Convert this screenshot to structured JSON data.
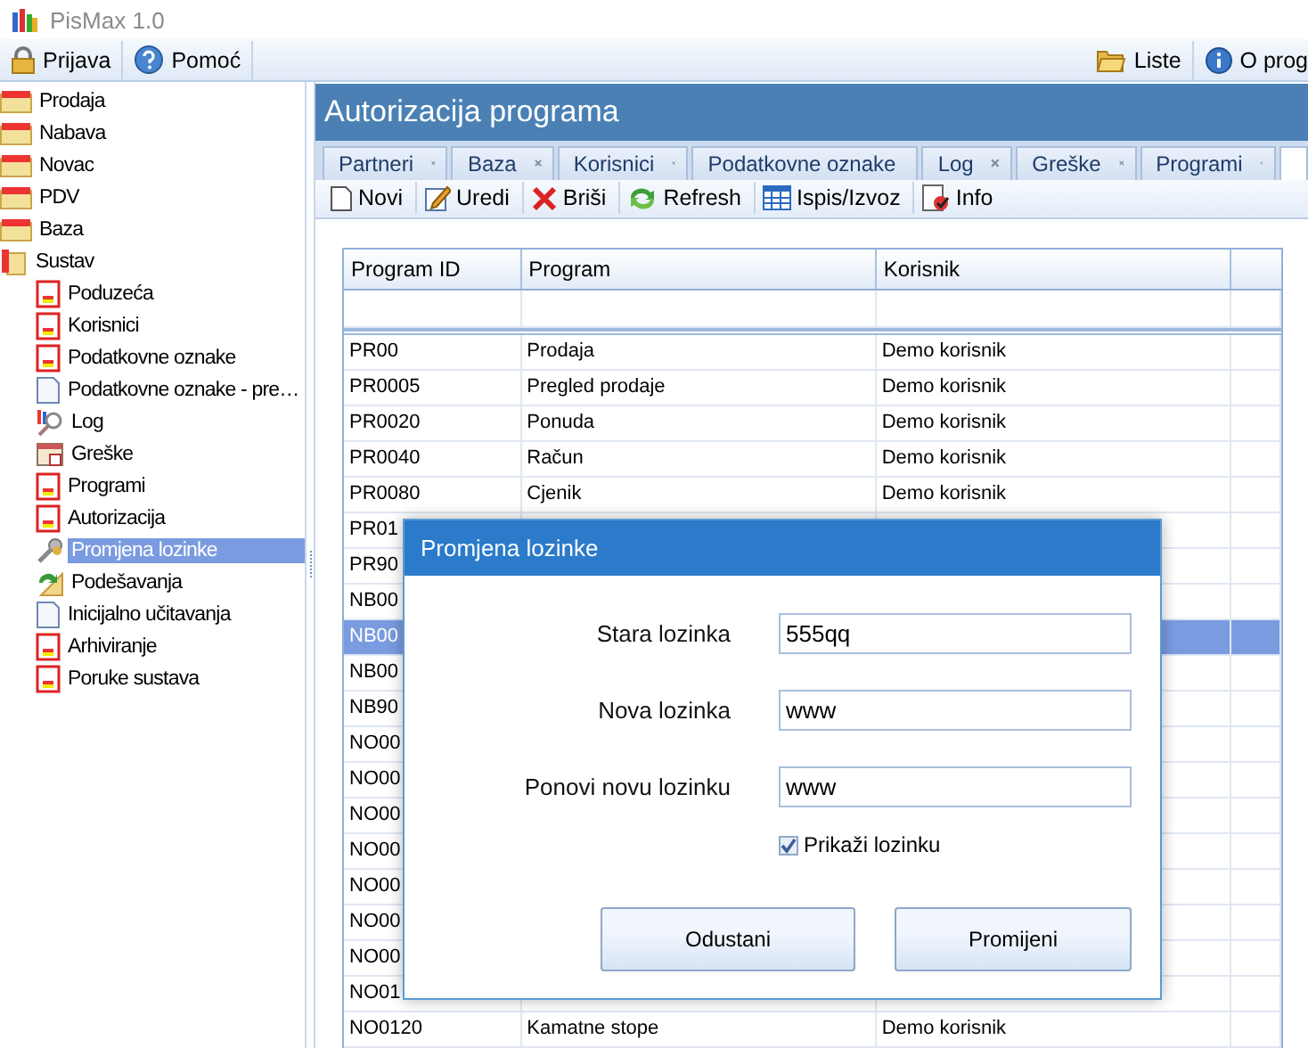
{
  "window": {
    "title": "PisMax 1.0"
  },
  "menu_bar": {
    "left": [
      {
        "label": "Prijava"
      },
      {
        "label": "Pomoć"
      }
    ],
    "right": [
      {
        "label": "Liste"
      },
      {
        "label": "O prog"
      }
    ]
  },
  "sidebar": {
    "items": [
      {
        "label": "Prodaja",
        "selected": false
      },
      {
        "label": "Nabava",
        "selected": false
      },
      {
        "label": "Novac",
        "selected": false
      },
      {
        "label": "PDV",
        "selected": false
      },
      {
        "label": "Baza",
        "selected": false
      },
      {
        "label": "Sustav",
        "selected": false,
        "expanded": true,
        "children": [
          {
            "label": "Poduzeća",
            "selected": false
          },
          {
            "label": "Korisnici",
            "selected": false
          },
          {
            "label": "Podatkovne oznake",
            "selected": false
          },
          {
            "label": "Podatkovne oznake - pre…",
            "selected": false
          },
          {
            "label": "Log",
            "selected": false
          },
          {
            "label": "Greške",
            "selected": false
          },
          {
            "label": "Programi",
            "selected": false
          },
          {
            "label": "Autorizacija",
            "selected": false
          },
          {
            "label": "Promjena lozinke",
            "selected": true
          },
          {
            "label": "Podešavanja",
            "selected": false
          },
          {
            "label": "Inicijalno učitavanja",
            "selected": false
          },
          {
            "label": "Arhiviranje",
            "selected": false
          },
          {
            "label": "Poruke sustava",
            "selected": false
          }
        ]
      }
    ]
  },
  "panel": {
    "title": "Autorizacija programa"
  },
  "tabs": [
    {
      "label": "Partneri",
      "selected": false
    },
    {
      "label": "Baza",
      "selected": false
    },
    {
      "label": "Korisnici",
      "selected": false
    },
    {
      "label": "Podatkovne oznake",
      "selected": false
    },
    {
      "label": "Log",
      "selected": false
    },
    {
      "label": "Greške",
      "selected": false
    },
    {
      "label": "Programi",
      "selected": false
    },
    {
      "selected": true
    }
  ],
  "toolbar": [
    "Novi",
    "Uredi",
    "Briši",
    "Refresh",
    "Ispis/Izvoz",
    "Info"
  ],
  "table": {
    "columns": [
      "Program ID",
      "Program",
      "Korisnik"
    ],
    "rows": [
      {
        "id": "PR00",
        "program": "Prodaja",
        "user": "Demo korisnik",
        "selected": false
      },
      {
        "id": "PR0005",
        "program": "Pregled prodaje",
        "user": "Demo korisnik",
        "selected": false
      },
      {
        "id": "PR0020",
        "program": "Ponuda",
        "user": "Demo korisnik",
        "selected": false
      },
      {
        "id": "PR0040",
        "program": "Račun",
        "user": "Demo korisnik",
        "selected": false
      },
      {
        "id": "PR0080",
        "program": "Cjenik",
        "user": "Demo korisnik",
        "selected": false
      },
      {
        "id": "PR01",
        "selected": false
      },
      {
        "id": "PR90",
        "selected": false
      },
      {
        "id": "NB00",
        "selected": false
      },
      {
        "id": "NB00",
        "selected": true
      },
      {
        "id": "NB00",
        "selected": false
      },
      {
        "id": "NB90",
        "selected": false
      },
      {
        "id": "NO00",
        "selected": false
      },
      {
        "id": "NO00",
        "selected": false
      },
      {
        "id": "NO00",
        "selected": false
      },
      {
        "id": "NO00",
        "selected": false
      },
      {
        "id": "NO00",
        "selected": false
      },
      {
        "id": "NO00",
        "selected": false
      },
      {
        "id": "NO00",
        "selected": false
      },
      {
        "id": "NO01",
        "selected": false
      },
      {
        "id": "NO0120",
        "program": "Kamatne stope",
        "user": "Demo korisnik",
        "selected": false
      }
    ]
  },
  "dialog": {
    "title": "Promjena lozinke",
    "fields": [
      {
        "label": "Stara lozinka",
        "value": "555qq"
      },
      {
        "label": "Nova lozinka",
        "value": "www"
      },
      {
        "label": "Ponovi novu lozinku",
        "value": "www"
      }
    ],
    "show_password": {
      "label": "Prikaži lozinku",
      "checked": true
    },
    "buttons": [
      "Odustani",
      "Promijeni"
    ]
  }
}
